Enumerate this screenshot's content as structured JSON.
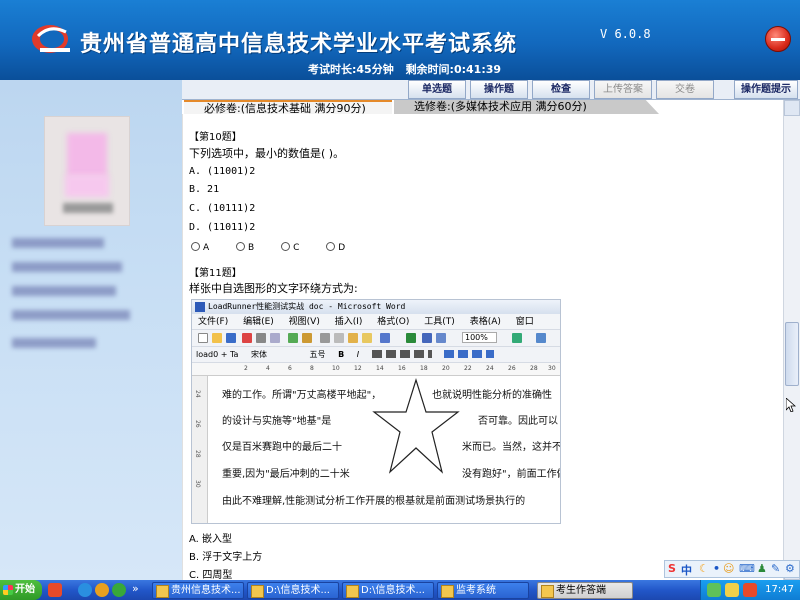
{
  "header": {
    "title": "贵州省普通高中信息技术学业水平考试系统",
    "version": "V 6.0.8",
    "exam_duration": "考试时长:45分钟",
    "remaining": "剩余时间:0:41:39"
  },
  "toolbar": {
    "single_choice": "单选题",
    "operation": "操作题",
    "check": "检查",
    "upload": "上传答案",
    "submit": "交卷",
    "hint": "操作题提示"
  },
  "tabs": {
    "required": "必修卷:(信息技术基础 满分90分)",
    "elective": "选修卷:(多媒体技术应用 满分60分)"
  },
  "q10": {
    "number": "【第10题】",
    "stem": "下列选项中，最小的数值是(      )。",
    "options": [
      "A. (11001)2",
      "B. 21",
      "C. (10111)2",
      "D. (11011)2"
    ],
    "radios": [
      "A",
      "B",
      "C",
      "D"
    ]
  },
  "q11": {
    "number": "【第11题】",
    "stem": "样张中自选图形的文字环绕方式为:",
    "options": [
      "A. 嵌入型",
      "B. 浮于文字上方",
      "C. 四周型"
    ]
  },
  "word": {
    "title": "LoadRunner性能测试实战 doc - Microsoft Word",
    "menus": [
      "文件(F)",
      "编辑(E)",
      "视图(V)",
      "插入(I)",
      "格式(O)",
      "工具(T)",
      "表格(A)",
      "窗口(W)"
    ],
    "zoom": "100%",
    "style": "load0 + Ta",
    "font": "宋体",
    "size": "五号",
    "bold": "B",
    "italic": "I",
    "ruler": [
      "2",
      "4",
      "6",
      "8",
      "10",
      "12",
      "14",
      "16",
      "18",
      "20",
      "22",
      "24",
      "26",
      "28",
      "30"
    ],
    "line_numbers": [
      "24",
      "26",
      "28",
      "30"
    ],
    "lines": [
      "难的工作。所谓\"万丈高楼平地起\"，",
      "的设计与实施等\"地基\"是",
      "仅是百米赛跑中的最后二十",
      "重要,因为\"最后冲刺的二十米",
      "由此不难理解,性能测试分析工作开展的根基就是前面测试场景执行的"
    ],
    "lines_right": [
      "也就说明性能分析的准确性",
      "否可靠。因此可以",
      "米而已。当然，这并不",
      "没有跑好\"，前面工作做"
    ]
  },
  "ime": {
    "label": "中"
  },
  "taskbar": {
    "start": "开始",
    "more": "»",
    "tasks": [
      "贵州信息技术...",
      "D:\\信息技术...",
      "D:\\信息技术...",
      "监考系统",
      "考生作答端"
    ],
    "clock": "17:47"
  },
  "colors": {
    "header_blue": "#1268bd",
    "sidebar": "#c7def4",
    "taskbar": "#2257c9",
    "tab_accent": "#e58a2a"
  }
}
